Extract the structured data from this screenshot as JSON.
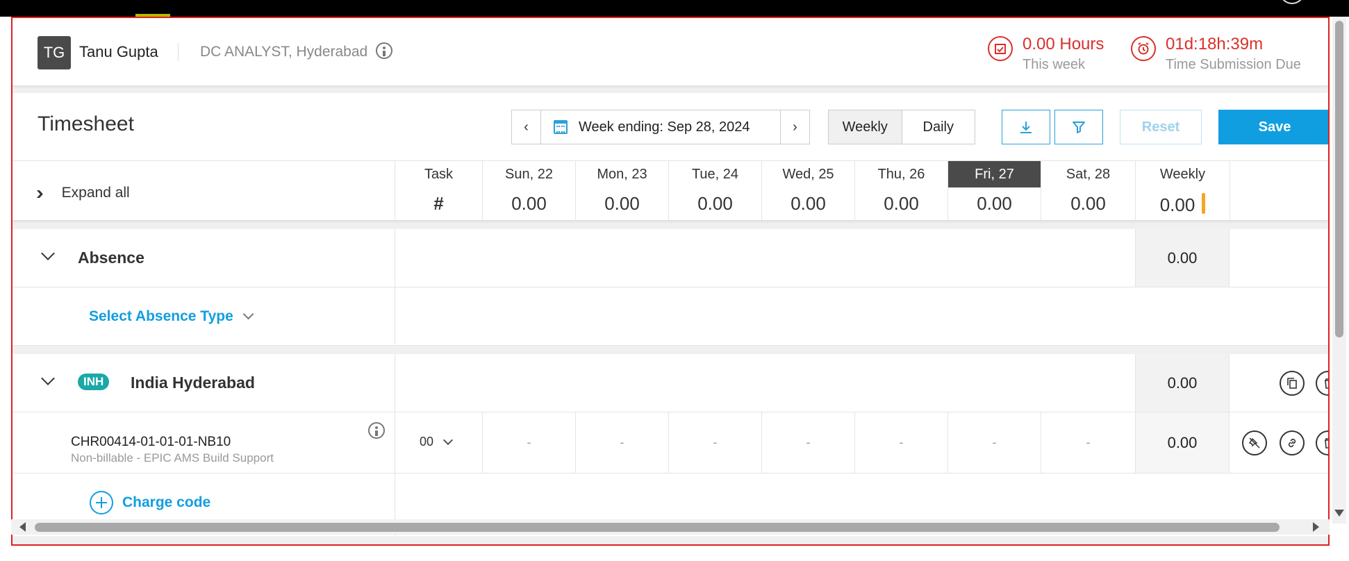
{
  "profile": {
    "initials": "TG",
    "name": "Tanu Gupta",
    "role": "DC ANALYST, Hyderabad",
    "hours_value": "0.00 Hours",
    "hours_label": "This week",
    "due_value": "01d:18h:39m",
    "due_label": "Time Submission Due"
  },
  "toolbar": {
    "title": "Timesheet",
    "week_ending": "Week ending: Sep 28, 2024",
    "view_weekly": "Weekly",
    "view_daily": "Daily",
    "reset_label": "Reset",
    "save_label": "Save"
  },
  "columns": {
    "expand_all": "Expand all",
    "task_label": "Task",
    "task_value": "#",
    "days": [
      {
        "label": "Sun, 22",
        "value": "0.00"
      },
      {
        "label": "Mon, 23",
        "value": "0.00"
      },
      {
        "label": "Tue, 24",
        "value": "0.00"
      },
      {
        "label": "Wed, 25",
        "value": "0.00"
      },
      {
        "label": "Thu, 26",
        "value": "0.00"
      },
      {
        "label": "Fri, 27",
        "value": "0.00"
      },
      {
        "label": "Sat, 28",
        "value": "0.00"
      }
    ],
    "weekly_label": "Weekly",
    "weekly_value": "0.00"
  },
  "absence": {
    "title": "Absence",
    "weekly": "0.00",
    "select_label": "Select Absence Type"
  },
  "project": {
    "badge": "INH",
    "title": "India Hyderabad",
    "weekly": "0.00",
    "charge_label": "Charge code"
  },
  "task_row": {
    "code": "CHR00414-01-01-01-NB10",
    "description": "Non-billable - EPIC AMS Build Support",
    "task_value": "00",
    "days": [
      "-",
      "-",
      "-",
      "-",
      "-",
      "-",
      "-"
    ],
    "weekly": "0.00"
  },
  "colors": {
    "accent_blue": "#119ee0",
    "alert_red": "#d9302b",
    "badge_teal": "#1aa8a8",
    "weekly_marker": "#f5a623"
  }
}
